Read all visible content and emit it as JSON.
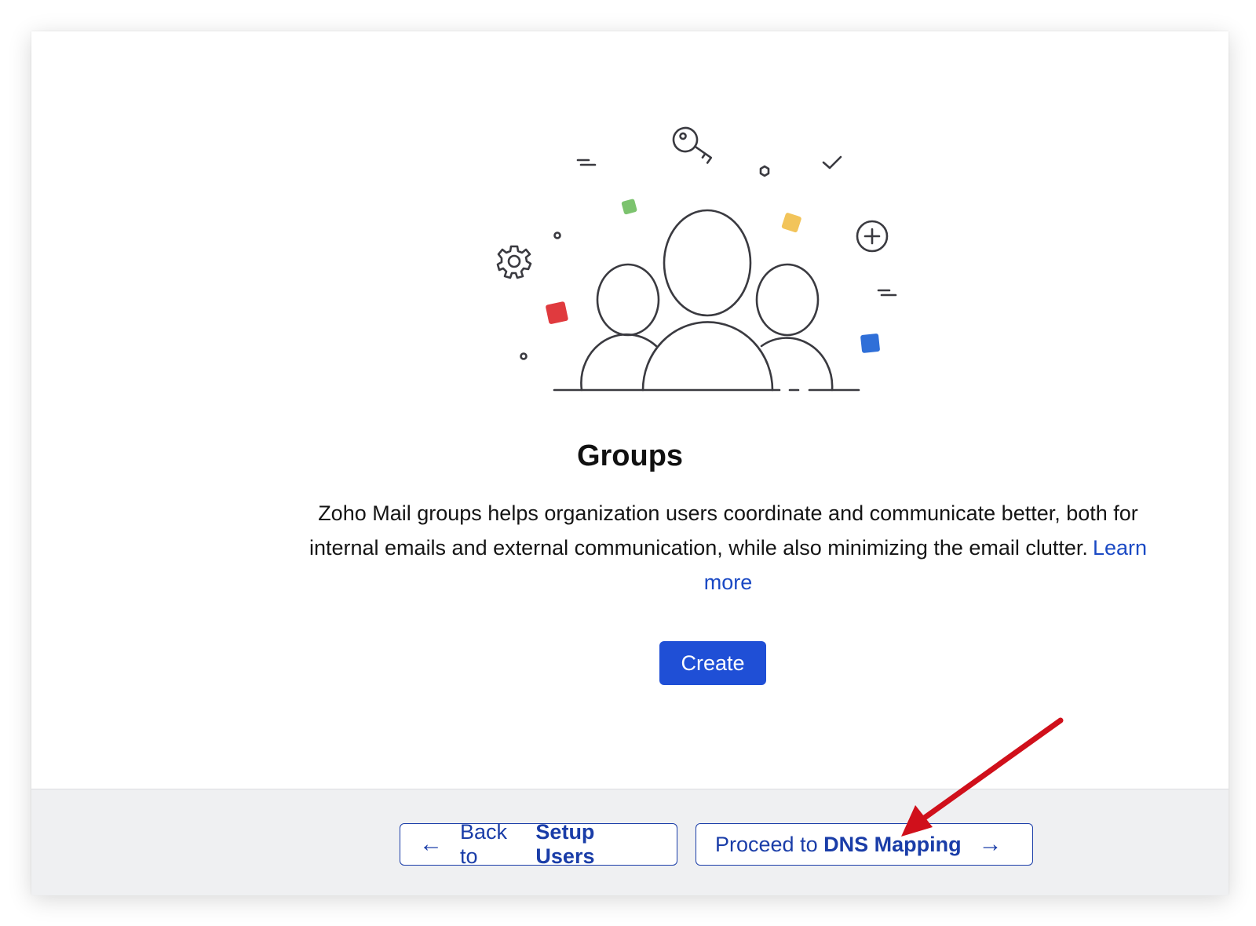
{
  "main": {
    "title": "Groups",
    "description": "Zoho Mail groups helps organization users coordinate and communicate better, both for internal emails and external communication, while also minimizing the email clutter.",
    "learn_more": "Learn more",
    "create_label": "Create"
  },
  "footer": {
    "back": {
      "prefix": "Back to",
      "target": "Setup Users",
      "icon": "arrow-left-icon"
    },
    "next": {
      "prefix": "Proceed to",
      "target": "DNS Mapping",
      "icon": "arrow-right-icon"
    }
  },
  "illustration": {
    "icons": [
      "key-icon",
      "gear-icon",
      "plus-circle-icon",
      "checkmark-icon",
      "hexagon-icon",
      "people-group-icon"
    ],
    "confetti_colors": [
      "#7cc36e",
      "#f2c45a",
      "#e03a3e",
      "#2f6fd8"
    ]
  },
  "colors": {
    "primary": "#1f4fd6",
    "link": "#1a49c4",
    "outline": "#1a3da8",
    "annotation": "#d0101b"
  }
}
